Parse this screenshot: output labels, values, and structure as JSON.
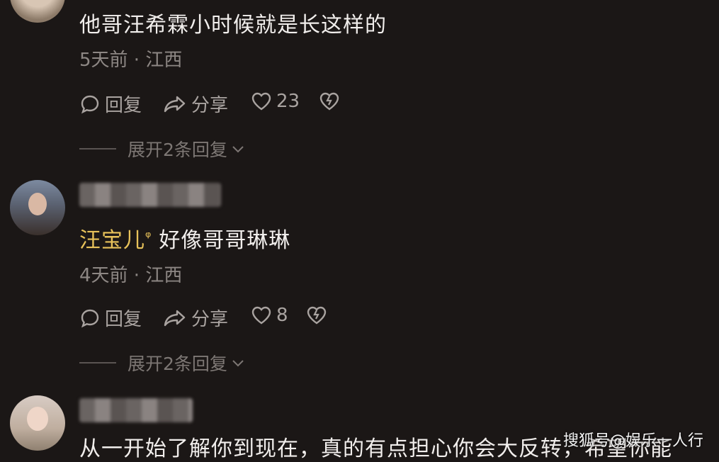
{
  "comments": [
    {
      "text": "他哥汪希霖小时候就是长这样的",
      "meta": "5天前 · 江西",
      "reply_label": "回复",
      "share_label": "分享",
      "like_count": "23",
      "expand_label": "展开2条回复"
    },
    {
      "mention": "汪宝儿",
      "text": "好像哥哥琳琳",
      "meta": "4天前 · 江西",
      "reply_label": "回复",
      "share_label": "分享",
      "like_count": "8",
      "expand_label": "展开2条回复"
    },
    {
      "text": "从一开始了解你到现在，真的有点担心你会大反转，希望你能"
    }
  ],
  "watermark": "搜狐号@娱乐一人行",
  "colors": {
    "background": "#1b1716",
    "mention": "#e8c25a",
    "meta": "#8d8784"
  }
}
